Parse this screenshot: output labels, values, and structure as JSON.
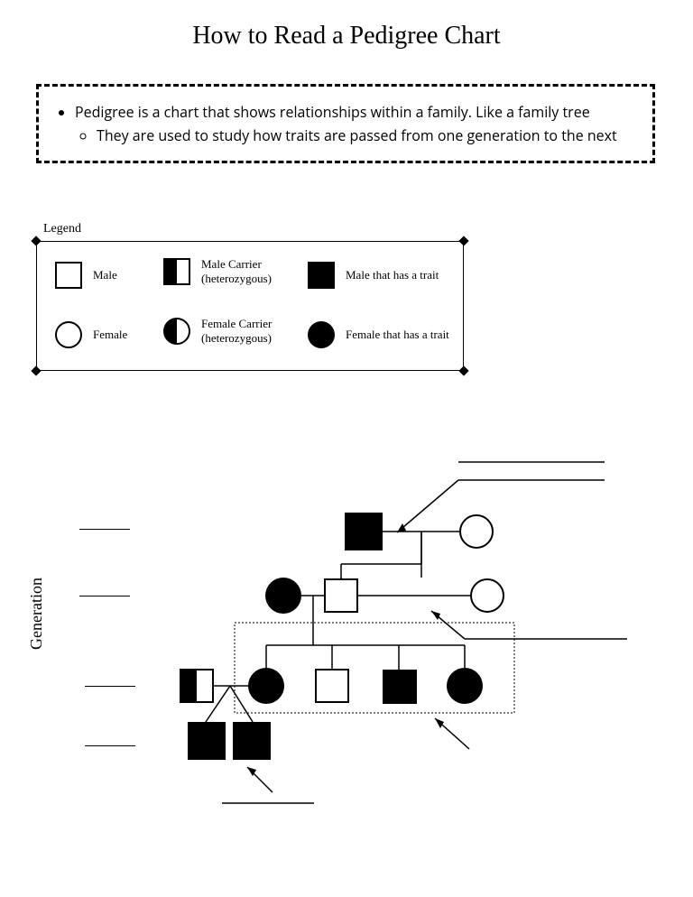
{
  "title": "How to Read a Pedigree Chart",
  "intro": {
    "bullet": "Pedigree is a chart that shows relationships within a family. Like a family tree",
    "sub_bullet": "They are used to study how traits are passed from one generation to the next"
  },
  "legend": {
    "label": "Legend",
    "items": [
      {
        "symbol": "male",
        "label": "Male"
      },
      {
        "symbol": "male_carrier",
        "label_line1": "Male Carrier",
        "label_line2": "(heterozygous)"
      },
      {
        "symbol": "male_trait",
        "label": "Male that has a trait"
      },
      {
        "symbol": "female",
        "label": "Female"
      },
      {
        "symbol": "female_carrier",
        "label_line1": "Female Carrier",
        "label_line2": "(heterozygous)"
      },
      {
        "symbol": "female_trait",
        "label": "Female that has a trait"
      }
    ]
  },
  "axis_label": "Generation",
  "chart_data": {
    "type": "pedigree",
    "generations": [
      {
        "gen": 1,
        "individuals": [
          {
            "id": "I-1",
            "sex": "male",
            "phenotype": "affected",
            "mate": "I-2"
          },
          {
            "id": "I-2",
            "sex": "female",
            "phenotype": "unaffected",
            "mate": "I-1"
          }
        ]
      },
      {
        "gen": 2,
        "individuals": [
          {
            "id": "II-1",
            "sex": "female",
            "phenotype": "affected",
            "parents": [
              "I-1",
              "I-2"
            ],
            "mate": "II-2"
          },
          {
            "id": "II-2",
            "sex": "male",
            "phenotype": "unaffected",
            "mate_left": "II-1",
            "mate_right": "II-3"
          },
          {
            "id": "II-3",
            "sex": "female",
            "phenotype": "unaffected",
            "mate": "II-2"
          }
        ]
      },
      {
        "gen": 3,
        "individuals": [
          {
            "id": "III-0",
            "sex": "male",
            "phenotype": "carrier",
            "mate": "III-1"
          },
          {
            "id": "III-1",
            "sex": "female",
            "phenotype": "affected",
            "parents": [
              "II-1",
              "II-2"
            ],
            "mate": "III-0"
          },
          {
            "id": "III-2",
            "sex": "male",
            "phenotype": "unaffected",
            "parents": [
              "II-1",
              "II-2"
            ]
          },
          {
            "id": "III-3",
            "sex": "male",
            "phenotype": "affected",
            "parents": [
              "II-1",
              "II-2"
            ]
          },
          {
            "id": "III-4",
            "sex": "female",
            "phenotype": "affected",
            "parents": [
              "II-1",
              "II-2"
            ]
          }
        ],
        "sibling_group": [
          "III-1",
          "III-2",
          "III-3",
          "III-4"
        ]
      },
      {
        "gen": 4,
        "individuals": [
          {
            "id": "IV-1",
            "sex": "male",
            "phenotype": "affected",
            "parents": [
              "III-0",
              "III-1"
            ]
          },
          {
            "id": "IV-2",
            "sex": "male",
            "phenotype": "affected",
            "parents": [
              "III-0",
              "III-1"
            ]
          }
        ]
      }
    ],
    "annotation_blanks": {
      "generation_row_blanks": 4,
      "callout_lines": 4
    }
  }
}
